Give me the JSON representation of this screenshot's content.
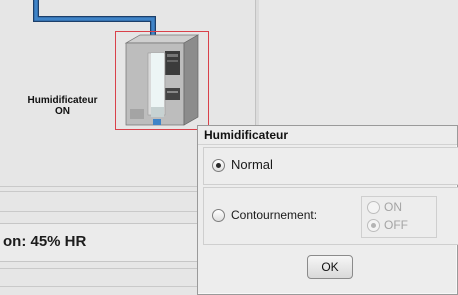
{
  "equipment": {
    "name": "Humidificateur",
    "state": "ON"
  },
  "humidity": {
    "text": "on: 45% HR"
  },
  "dialog": {
    "title": "Humidificateur",
    "options": {
      "normal_label": "Normal",
      "normal_selected": true,
      "bypass_label": "Contournement:",
      "bypass_selected": false,
      "bypass_on_label": "ON",
      "bypass_off_label": "OFF",
      "bypass_value": "OFF"
    },
    "ok_label": "OK"
  },
  "colors": {
    "pipe": "#2f6fb2",
    "selection_border": "#d9414a"
  }
}
